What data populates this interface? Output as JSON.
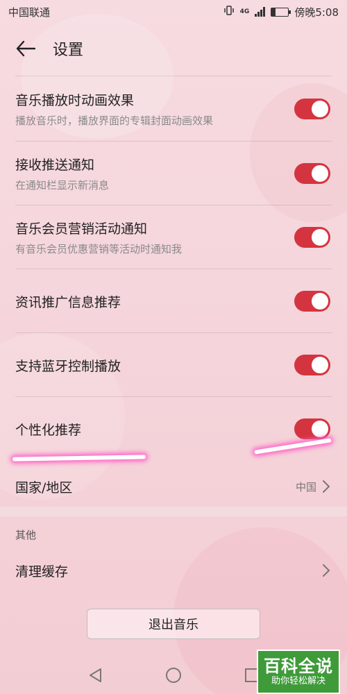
{
  "status": {
    "carrier": "中国联通",
    "time": "傍晚5:08",
    "network": "4G"
  },
  "header": {
    "title": "设置"
  },
  "settings": [
    {
      "title": "音乐播放时动画效果",
      "subtitle": "播放音乐时，播放界面的专辑封面动画效果",
      "enabled": true
    },
    {
      "title": "接收推送通知",
      "subtitle": "在通知栏显示新消息",
      "enabled": true
    },
    {
      "title": "音乐会员营销活动通知",
      "subtitle": "有音乐会员优惠营销等活动时通知我",
      "enabled": true
    },
    {
      "title": "资讯推广信息推荐",
      "enabled": true
    },
    {
      "title": "支持蓝牙控制播放",
      "enabled": true
    },
    {
      "title": "个性化推荐",
      "enabled": true
    }
  ],
  "region": {
    "label": "国家/地区",
    "value": "中国"
  },
  "other": {
    "section_title": "其他",
    "clear_cache": "清理缓存"
  },
  "exit_button": "退出音乐",
  "watermark": {
    "main": "百科全说",
    "sub": "助你轻松解决"
  },
  "colors": {
    "toggle_on": "#d4343f",
    "highlight": "#ff5fc6"
  }
}
